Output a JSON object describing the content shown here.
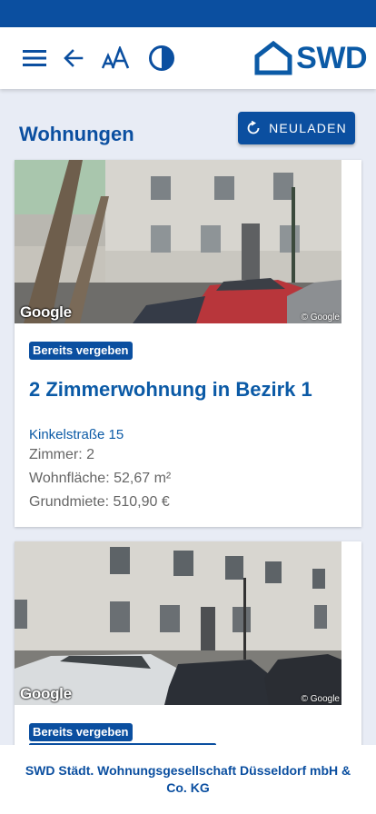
{
  "header": {
    "menu_icon": "menu-icon",
    "back_icon": "arrow-left-icon",
    "font_size_icon": "text-size-icon",
    "contrast_icon": "contrast-icon",
    "logo_text": "SWD"
  },
  "main": {
    "title": "Wohnungen",
    "reload_label": "NEULADEN",
    "reload_icon": "refresh-icon"
  },
  "listings": [
    {
      "image_credit_left": "Google",
      "image_credit_right": "© Google",
      "badge": "Bereits vergeben",
      "title": "2 Zimmerwohnung in Bezirk 1",
      "street": "Kinkelstraße 15",
      "rooms": "Zimmer: 2",
      "area": "Wohnfläche: 52,67 m²",
      "rent": "Grundmiete: 510,90 €"
    },
    {
      "image_credit_left": "Google",
      "image_credit_right": "© Google",
      "badge": "Bereits vergeben"
    }
  ],
  "footer": {
    "company": "SWD Städt. Wohnungsgesellschaft Düsseldorf mbH & Co. KG"
  },
  "colors": {
    "primary": "#0b4fa0",
    "background": "#e8ecf5"
  }
}
